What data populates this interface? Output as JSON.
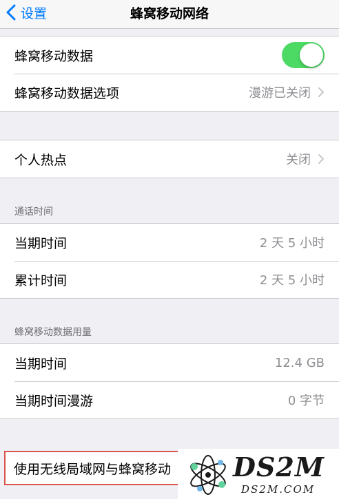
{
  "navbar": {
    "back_label": "设置",
    "title": "蜂窝移动网络"
  },
  "cellular": {
    "data_label": "蜂窝移动数据",
    "data_toggle_on": true,
    "options_label": "蜂窝移动数据选项",
    "options_value": "漫游已关闭"
  },
  "hotspot": {
    "label": "个人热点",
    "value": "关闭"
  },
  "call_time": {
    "header": "通话时间",
    "current_label": "当期时间",
    "current_value": "2 天 5 小时",
    "lifetime_label": "累计时间",
    "lifetime_value": "2 天 5 小时"
  },
  "data_usage": {
    "header": "蜂窝移动数据用量",
    "current_label": "当期时间",
    "current_value": "12.4 GB",
    "roaming_label": "当期时间漫游",
    "roaming_value": "0 字节"
  },
  "wlan_assist": {
    "label": "使用无线局域网与蜂窝移动"
  },
  "watermark": {
    "big_text": "DS2M",
    "small_text": "DS2M.COM"
  },
  "colors": {
    "accent": "#007aff",
    "toggle_on": "#4cd964",
    "highlight": "#d9534f"
  }
}
